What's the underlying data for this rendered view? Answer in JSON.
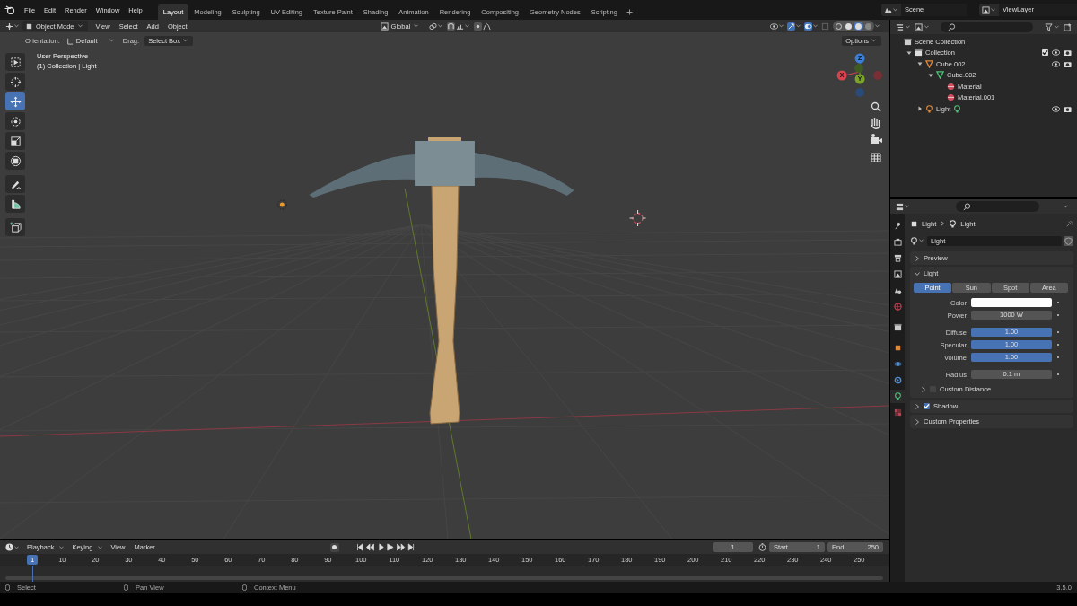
{
  "topbar": {
    "menus": [
      "File",
      "Edit",
      "Render",
      "Window",
      "Help"
    ],
    "workspaces": [
      {
        "label": "Layout",
        "selected": true
      },
      {
        "label": "Modeling",
        "selected": false
      },
      {
        "label": "Sculpting",
        "selected": false
      },
      {
        "label": "UV Editing",
        "selected": false
      },
      {
        "label": "Texture Paint",
        "selected": false
      },
      {
        "label": "Shading",
        "selected": false
      },
      {
        "label": "Animation",
        "selected": false
      },
      {
        "label": "Rendering",
        "selected": false
      },
      {
        "label": "Compositing",
        "selected": false
      },
      {
        "label": "Geometry Nodes",
        "selected": false
      },
      {
        "label": "Scripting",
        "selected": false
      }
    ],
    "scene": "Scene",
    "view_layer": "ViewLayer"
  },
  "viewport": {
    "mode": "Object Mode",
    "menus": [
      "View",
      "Select",
      "Add",
      "Object"
    ],
    "transform_orientation": "Global",
    "orientation_label": "Orientation:",
    "orientation": "Default",
    "drag_label": "Drag:",
    "drag": "Select Box",
    "options": "Options",
    "overlay_text": [
      "User Perspective",
      "(1) Collection | Light"
    ],
    "tools": [
      {
        "kind": "select",
        "selected": false
      },
      {
        "kind": "cursor",
        "selected": false
      },
      {
        "kind": "move",
        "selected": true
      },
      {
        "kind": "rotate",
        "selected": false
      },
      {
        "kind": "scale",
        "selected": false
      },
      {
        "kind": "transform",
        "selected": false
      },
      {
        "kind": "annotate",
        "selected": false
      },
      {
        "kind": "measure",
        "selected": false
      },
      {
        "kind": "add-cube",
        "selected": false
      }
    ],
    "shading": [
      {
        "selected": false
      },
      {
        "selected": false
      },
      {
        "selected": true
      },
      {
        "selected": false
      }
    ],
    "gizmo_axes": [
      "Z",
      "X",
      "Y"
    ]
  },
  "outliner": {
    "tree": [
      {
        "label": "Scene Collection",
        "kind": "scene",
        "children": [
          {
            "label": "Collection",
            "kind": "collection",
            "expanded": true,
            "checked": true,
            "children": [
              {
                "label": "Cube.002",
                "kind": "mesh-object",
                "expanded": true,
                "children": [
                  {
                    "label": "Cube.002",
                    "kind": "mesh-data",
                    "expanded": true,
                    "children": [
                      {
                        "label": "Material",
                        "kind": "material"
                      },
                      {
                        "label": "Material.001",
                        "kind": "material"
                      }
                    ]
                  }
                ]
              },
              {
                "label": "Light",
                "kind": "light-object",
                "expanded": false
              }
            ]
          }
        ]
      }
    ]
  },
  "properties": {
    "tabs": [
      {
        "kind": "tool",
        "selected": false
      },
      {
        "kind": "render",
        "selected": false
      },
      {
        "kind": "output",
        "selected": false
      },
      {
        "kind": "view-layer",
        "selected": false
      },
      {
        "kind": "scene",
        "selected": false
      },
      {
        "kind": "world",
        "selected": false
      },
      {
        "kind": "collection",
        "selected": false
      },
      {
        "kind": "object",
        "selected": false
      },
      {
        "kind": "physics",
        "selected": false
      },
      {
        "kind": "constraints",
        "selected": false
      },
      {
        "kind": "light",
        "selected": true
      },
      {
        "kind": "texture",
        "selected": false
      }
    ],
    "breadcrumb": [
      "Light",
      "Light"
    ],
    "datablock": "Light",
    "panels": [
      {
        "title": "Preview",
        "expanded": false
      },
      {
        "title": "Light",
        "expanded": true,
        "types": [
          {
            "label": "Point",
            "selected": true
          },
          {
            "label": "Sun",
            "selected": false
          },
          {
            "label": "Spot",
            "selected": false
          },
          {
            "label": "Area",
            "selected": false
          }
        ],
        "groups": [
          [
            {
              "kind": "color",
              "label": "Color",
              "color": "#ffffff"
            },
            {
              "kind": "number",
              "label": "Power",
              "value": "1000 W"
            }
          ],
          [
            {
              "kind": "slider",
              "label": "Diffuse",
              "value": "1.00",
              "level": 1
            },
            {
              "kind": "slider",
              "label": "Specular",
              "value": "1.00",
              "level": 1
            },
            {
              "kind": "slider",
              "label": "Volume",
              "value": "1.00",
              "level": 1
            }
          ],
          [
            {
              "kind": "number",
              "label": "Radius",
              "value": "0.1 m"
            }
          ]
        ],
        "subpanel": {
          "title": "Custom Distance",
          "expanded": false,
          "checked": false
        }
      },
      {
        "title": "Shadow",
        "expanded": false,
        "checked": true
      },
      {
        "title": "Custom Properties",
        "expanded": false
      }
    ]
  },
  "timeline": {
    "menus": [
      "Playback",
      "Keying",
      "View",
      "Marker"
    ],
    "current_frame": "1",
    "start_label": "Start",
    "start": "1",
    "end_label": "End",
    "end": "250",
    "ruler": [
      "1",
      "10",
      "20",
      "30",
      "40",
      "50",
      "60",
      "70",
      "80",
      "90",
      "100",
      "110",
      "120",
      "130",
      "140",
      "150",
      "160",
      "170",
      "180",
      "190",
      "200",
      "210",
      "220",
      "230",
      "240",
      "250"
    ]
  },
  "status_bar": {
    "hints": [
      "Select",
      "Pan View",
      "Context Menu"
    ],
    "version": "3.5.0"
  }
}
